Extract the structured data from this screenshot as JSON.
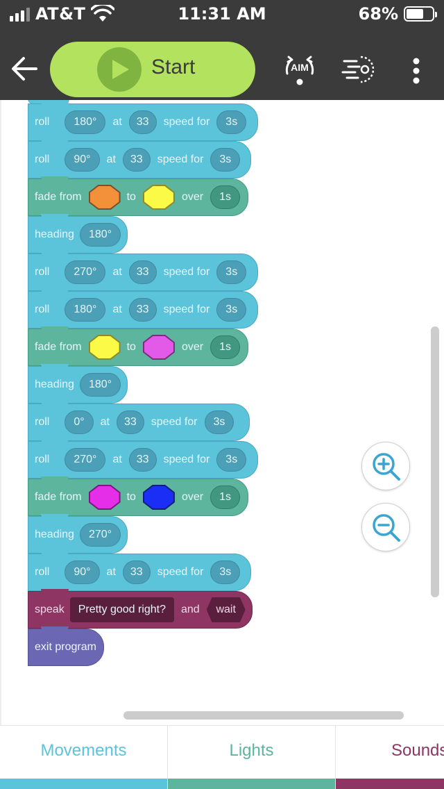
{
  "status_bar": {
    "carrier": "AT&T",
    "time": "11:31 AM",
    "battery_percent": "68%",
    "battery_level": 0.68,
    "signal_bars": 3
  },
  "toolbar": {
    "back_icon": "arrow-left-icon",
    "start_label": "Start",
    "aim_label": "AIM",
    "timeline_icon": "timeline-icon",
    "menu_icon": "more-vertical-icon"
  },
  "blocks": [
    {
      "type": "roll",
      "kw1": "roll",
      "heading": "180°",
      "kw2": "at",
      "speed": "33",
      "kw3": "speed for",
      "duration": "3s"
    },
    {
      "type": "roll",
      "kw1": "roll",
      "heading": "90°",
      "kw2": "at",
      "speed": "33",
      "kw3": "speed for",
      "duration": "3s"
    },
    {
      "type": "fade",
      "kw1": "fade from",
      "from_color": "#f3913a",
      "kw2": "to",
      "to_color": "#fbfa47",
      "kw3": "over",
      "duration": "1s"
    },
    {
      "type": "heading",
      "kw1": "heading",
      "heading": "180°"
    },
    {
      "type": "roll",
      "kw1": "roll",
      "heading": "270°",
      "kw2": "at",
      "speed": "33",
      "kw3": "speed for",
      "duration": "3s"
    },
    {
      "type": "roll",
      "kw1": "roll",
      "heading": "180°",
      "kw2": "at",
      "speed": "33",
      "kw3": "speed for",
      "duration": "3s"
    },
    {
      "type": "fade",
      "kw1": "fade from",
      "from_color": "#fbfa47",
      "kw2": "to",
      "to_color": "#e45ae8",
      "kw3": "over",
      "duration": "1s"
    },
    {
      "type": "heading",
      "kw1": "heading",
      "heading": "180°"
    },
    {
      "type": "roll",
      "kw1": "roll",
      "heading": "0°",
      "kw2": "at",
      "speed": "33",
      "kw3": "speed for",
      "duration": "3s"
    },
    {
      "type": "roll",
      "kw1": "roll",
      "heading": "270°",
      "kw2": "at",
      "speed": "33",
      "kw3": "speed for",
      "duration": "3s"
    },
    {
      "type": "fade",
      "kw1": "fade from",
      "from_color": "#e42ee8",
      "kw2": "to",
      "to_color": "#1a2ef5",
      "kw3": "over",
      "duration": "1s"
    },
    {
      "type": "heading",
      "kw1": "heading",
      "heading": "270°"
    },
    {
      "type": "roll",
      "kw1": "roll",
      "heading": "90°",
      "kw2": "at",
      "speed": "33",
      "kw3": "speed for",
      "duration": "3s"
    },
    {
      "type": "speak",
      "kw1": "speak",
      "text": "Pretty good right?",
      "kw2": "and",
      "mode": "wait"
    },
    {
      "type": "exit",
      "kw1": "exit program"
    }
  ],
  "zoom": {
    "zoom_in_icon": "zoom-in-icon",
    "zoom_out_icon": "zoom-out-icon"
  },
  "tabs": [
    {
      "label": "Movements",
      "color": "#5bc3da"
    },
    {
      "label": "Lights",
      "color": "#5cb59c"
    },
    {
      "label": "Sounds",
      "color": "#8e3563"
    }
  ]
}
